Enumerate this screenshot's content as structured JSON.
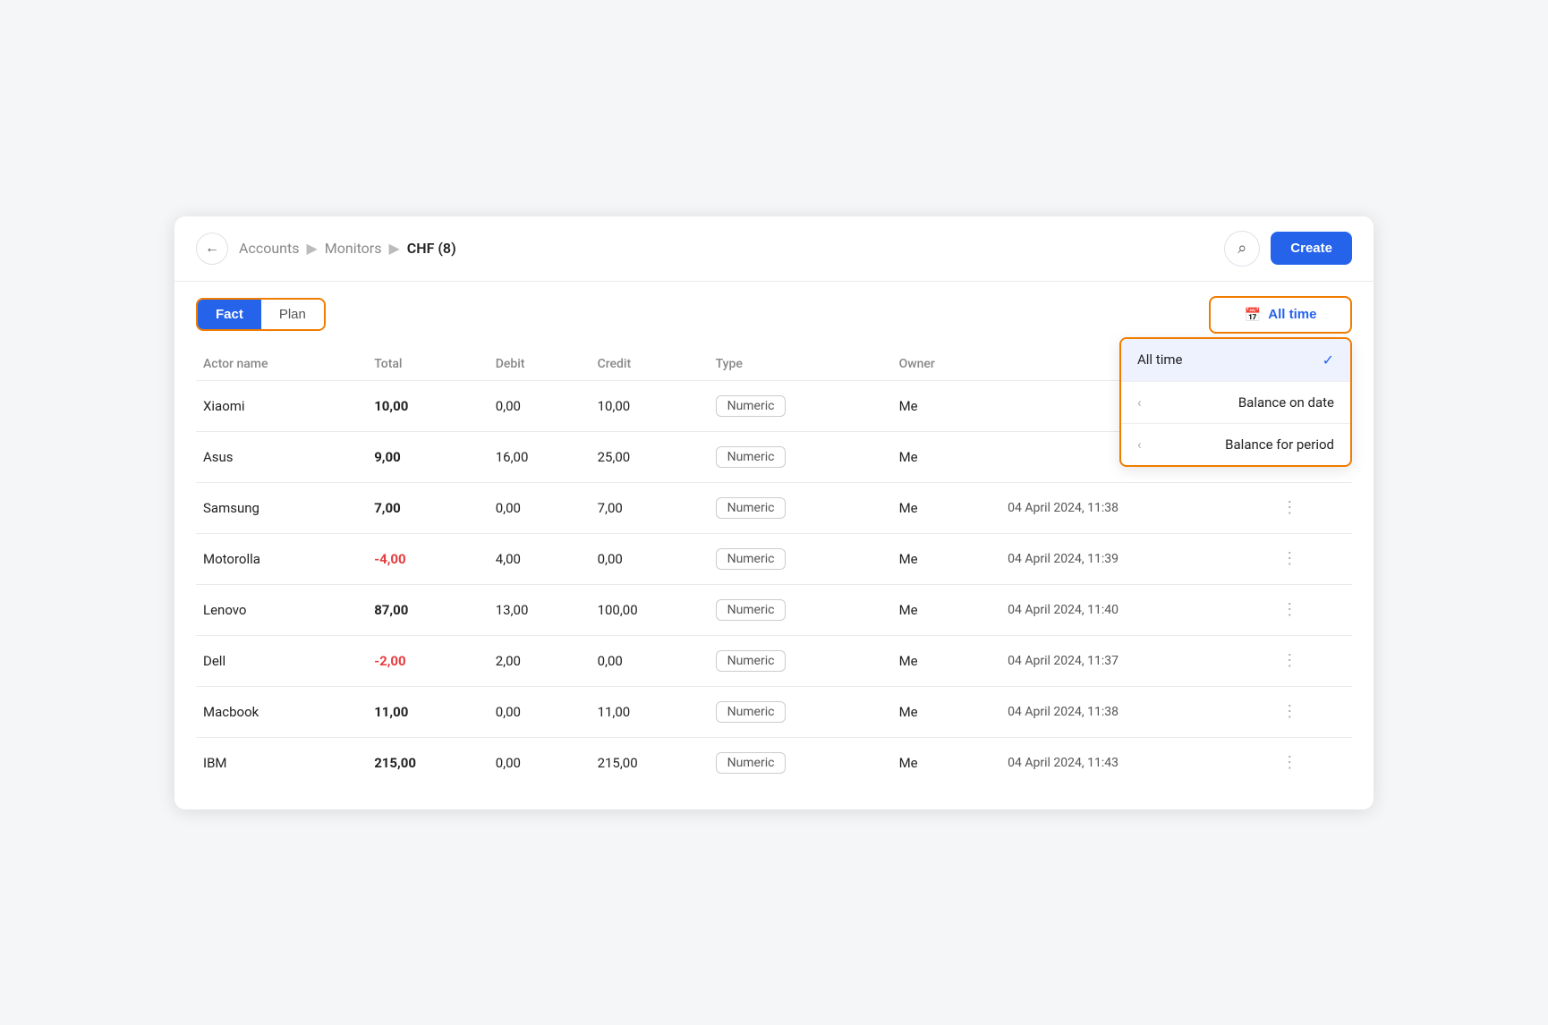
{
  "header": {
    "back_label": "←",
    "breadcrumb": {
      "accounts": "Accounts",
      "sep1": "▶",
      "monitors": "Monitors",
      "sep2": "▶",
      "current": "CHF (8)"
    },
    "search_label": "🔍",
    "create_label": "Create"
  },
  "toolbar": {
    "fact_label": "Fact",
    "plan_label": "Plan",
    "time_filter_label": "All time",
    "calendar_icon": "📅"
  },
  "dropdown": {
    "items": [
      {
        "label": "All time",
        "selected": true,
        "has_chevron": false
      },
      {
        "label": "Balance on date",
        "selected": false,
        "has_chevron": true
      },
      {
        "label": "Balance for period",
        "selected": false,
        "has_chevron": true
      }
    ]
  },
  "table": {
    "columns": [
      "Actor name",
      "Total",
      "Debit",
      "Credit",
      "Type",
      "Owner",
      ""
    ],
    "rows": [
      {
        "actor": "Xiaomi",
        "total": "10,00",
        "negative": false,
        "debit": "0,00",
        "credit": "10,00",
        "type": "Numeric",
        "owner": "Me",
        "date": "",
        "show_dots": false
      },
      {
        "actor": "Asus",
        "total": "9,00",
        "negative": false,
        "debit": "16,00",
        "credit": "25,00",
        "type": "Numeric",
        "owner": "Me",
        "date": "",
        "show_dots": false
      },
      {
        "actor": "Samsung",
        "total": "7,00",
        "negative": false,
        "debit": "0,00",
        "credit": "7,00",
        "type": "Numeric",
        "owner": "Me",
        "date": "04 April 2024, 11:38",
        "show_dots": true
      },
      {
        "actor": "Motorolla",
        "total": "-4,00",
        "negative": true,
        "debit": "4,00",
        "credit": "0,00",
        "type": "Numeric",
        "owner": "Me",
        "date": "04 April 2024, 11:39",
        "show_dots": true
      },
      {
        "actor": "Lenovo",
        "total": "87,00",
        "negative": false,
        "debit": "13,00",
        "credit": "100,00",
        "type": "Numeric",
        "owner": "Me",
        "date": "04 April 2024, 11:40",
        "show_dots": true
      },
      {
        "actor": "Dell",
        "total": "-2,00",
        "negative": true,
        "debit": "2,00",
        "credit": "0,00",
        "type": "Numeric",
        "owner": "Me",
        "date": "04 April 2024, 11:37",
        "show_dots": true
      },
      {
        "actor": "Macbook",
        "total": "11,00",
        "negative": false,
        "debit": "0,00",
        "credit": "11,00",
        "type": "Numeric",
        "owner": "Me",
        "date": "04 April 2024, 11:38",
        "show_dots": true
      },
      {
        "actor": "IBM",
        "total": "215,00",
        "negative": false,
        "debit": "0,00",
        "credit": "215,00",
        "type": "Numeric",
        "owner": "Me",
        "date": "04 April 2024, 11:43",
        "show_dots": true
      }
    ]
  }
}
